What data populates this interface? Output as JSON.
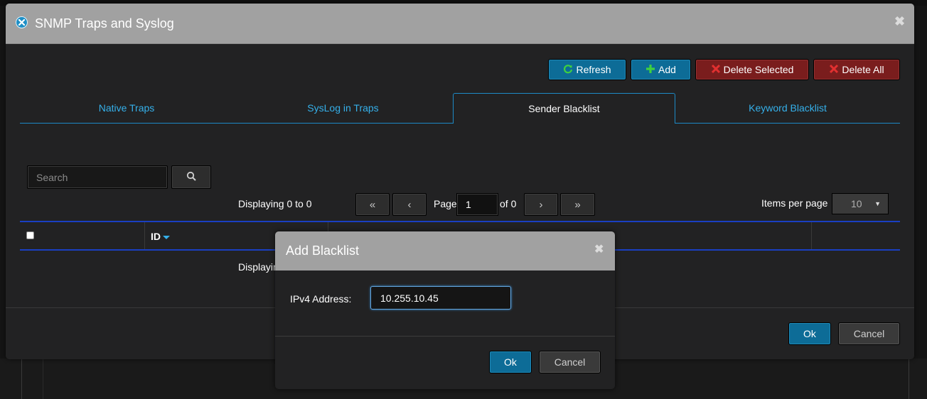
{
  "dialog": {
    "title": "SNMP Traps and Syslog",
    "close_glyph": "✖"
  },
  "toolbar": {
    "refresh_label": "Refresh",
    "add_label": "Add",
    "delete_selected_label": "Delete Selected",
    "delete_all_label": "Delete All"
  },
  "tabs": [
    {
      "label": "Native Traps",
      "active": false
    },
    {
      "label": "SysLog in Traps",
      "active": false
    },
    {
      "label": "Sender Blacklist",
      "active": true
    },
    {
      "label": "Keyword Blacklist",
      "active": false
    }
  ],
  "search": {
    "placeholder": "Search",
    "value": ""
  },
  "pagination": {
    "displaying": "Displaying 0 to 0",
    "first": "«",
    "prev": "‹",
    "page_label": "Page",
    "page_value": "1",
    "of_label": "of 0",
    "next": "›",
    "last": "»",
    "items_per_page_label": "Items per page",
    "items_per_page_value": "10"
  },
  "grid": {
    "columns": [
      "ID"
    ],
    "footer_text": "Displayin"
  },
  "footer": {
    "ok_label": "Ok",
    "cancel_label": "Cancel"
  },
  "modal": {
    "title": "Add Blacklist",
    "close_glyph": "✖",
    "ipv4_label": "IPv4 Address:",
    "ipv4_value": "10.255.10.45",
    "ok_label": "Ok",
    "cancel_label": "Cancel"
  },
  "colors": {
    "header_gray": "#a1a1a1",
    "panel": "#222223",
    "accent_blue": "#0d6c97",
    "tab_blue": "#35b0ea",
    "danger_red": "#7a1d1d",
    "refresh_green": "#3fd13f",
    "delete_red_icon": "#e23030"
  }
}
